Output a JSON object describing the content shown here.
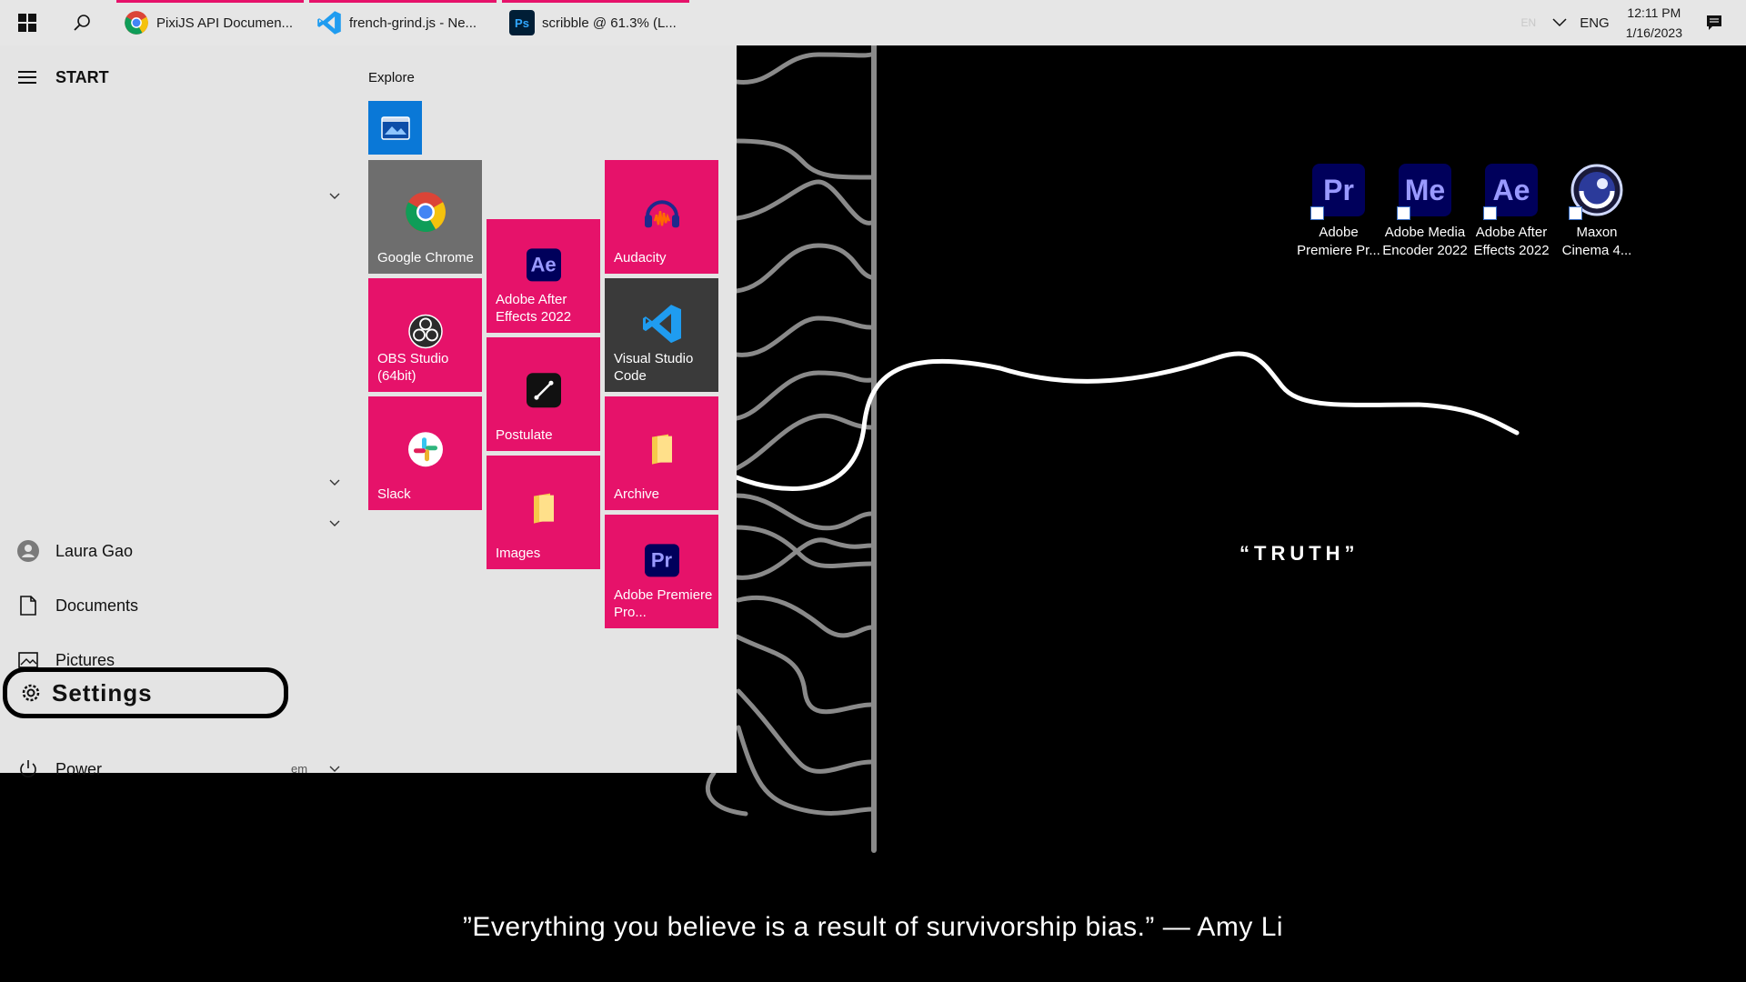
{
  "taskbar": {
    "apps": [
      {
        "label": "PixiJS API Documen...",
        "icon": "chrome-icon"
      },
      {
        "label": "french-grind.js - Ne...",
        "icon": "vscode-icon"
      },
      {
        "label": "scribble @ 61.3% (L...",
        "icon": "photoshop-icon"
      }
    ],
    "tray": {
      "ime": "EN",
      "lang": "ENG",
      "time": "12:11 PM",
      "date": "1/16/2023"
    },
    "accent_color": "#e6126a"
  },
  "start": {
    "title": "START",
    "user": "Laura Gao",
    "items": {
      "documents": "Documents",
      "pictures": "Pictures",
      "settings": "Settings",
      "power": "Power"
    },
    "group_label": "Explore",
    "tail_text": "em",
    "tiles": {
      "chrome": "Google Chrome",
      "after_effects": "Adobe After Effects 2022",
      "audacity": "Audacity",
      "obs": "OBS Studio (64bit)",
      "vscode": "Visual Studio Code",
      "postulate": "Postulate",
      "slack": "Slack",
      "archive": "Archive",
      "images": "Images",
      "premiere": "Adobe Premiere Pro..."
    },
    "tile_icons": {
      "after_effects": "Ae",
      "premiere": "Pr"
    }
  },
  "desktop": {
    "icons": [
      {
        "abbr": "Pr",
        "label_1": "Adobe",
        "label_2": "Premiere Pr...",
        "color": "#9999ff"
      },
      {
        "abbr": "Me",
        "label_1": "Adobe Media",
        "label_2": "Encoder 2022",
        "color": "#9999ff"
      },
      {
        "abbr": "Ae",
        "label_1": "Adobe After",
        "label_2": "Effects 2022",
        "color": "#9999ff"
      },
      {
        "abbr": "",
        "label_1": "Maxon",
        "label_2": "Cinema 4...",
        "color": "#ffffff"
      }
    ],
    "truth": "“TRUTH”",
    "quote": "”Everything you believe is a result of survivorship bias.” — Amy Li"
  }
}
